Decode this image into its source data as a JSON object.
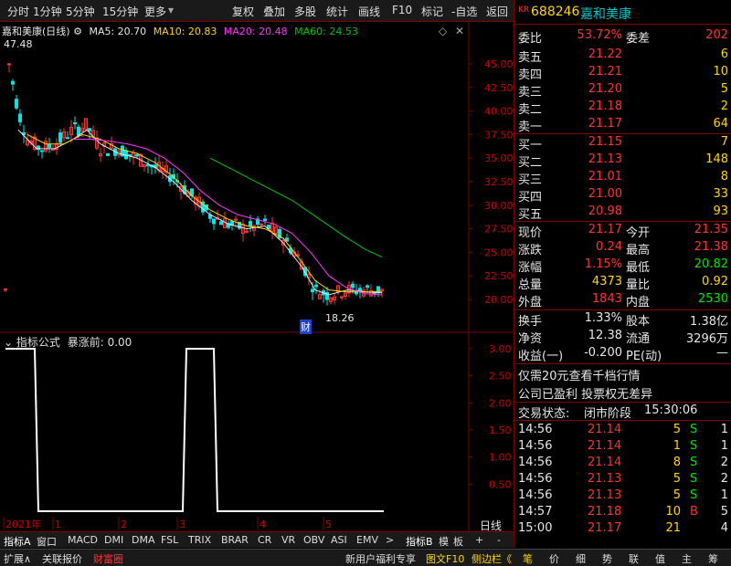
{
  "toolbar": {
    "left": [
      "分时",
      "1分钟",
      "5分钟",
      "15分钟",
      "更多"
    ],
    "right": [
      "复权",
      "叠加",
      "多股",
      "统计",
      "画线",
      "F10",
      "标记",
      "-自选",
      "返回"
    ]
  },
  "chart": {
    "stock_name": "嘉和美康(日线)",
    "ma5": "MA5: 20.70",
    "ma10": "MA10: 20.83",
    "ma20": "MA20: 20.48",
    "ma60": "MA60: 24.53",
    "high_mark": "47.48",
    "low_mark": "18.26",
    "cai_marker": "财",
    "y_ticks": [
      "45.00",
      "42.50",
      "40.00",
      "37.50",
      "35.00",
      "32.50",
      "30.00",
      "27.50",
      "25.00",
      "22.50",
      "20.00"
    ],
    "sub_y_ticks": [
      "3.00",
      "2.50",
      "2.00",
      "1.50",
      "1.00",
      "0.50"
    ],
    "x_labels": [
      "2021年",
      "1",
      "2",
      "3",
      "4",
      "5"
    ],
    "period_label": "日线"
  },
  "indicator": {
    "title": "指标公式",
    "value_label": "暴涨前: 0.00"
  },
  "index_tabs": [
    "指标A",
    "窗口",
    "MACD",
    "DMI",
    "DMA",
    "FSL",
    "TRIX",
    "BRAR",
    "CR",
    "VR",
    "OBV",
    "ASI",
    "EMV",
    ">",
    "指标B",
    "模",
    "板",
    "+",
    "-"
  ],
  "status_bar": {
    "left": [
      "扩展∧",
      "关联报价",
      "财富圈"
    ],
    "promo": "新用户福利专享",
    "f10": "图文F10",
    "sidebar": "侧边栏《",
    "right_tabs": [
      "笔",
      "价",
      "细",
      "势",
      "联",
      "值",
      "主",
      "筹"
    ]
  },
  "quote": {
    "prefix": "KR",
    "code": "688246",
    "name": "嘉和美康",
    "weibi_label": "委比",
    "weibi": "53.72%",
    "weicha_label": "委差",
    "weicha": "202",
    "asks": [
      {
        "label": "卖五",
        "price": "21.22",
        "vol": "6"
      },
      {
        "label": "卖四",
        "price": "21.21",
        "vol": "10"
      },
      {
        "label": "卖三",
        "price": "21.20",
        "vol": "5"
      },
      {
        "label": "卖二",
        "price": "21.18",
        "vol": "2"
      },
      {
        "label": "卖一",
        "price": "21.17",
        "vol": "64"
      }
    ],
    "bids": [
      {
        "label": "买一",
        "price": "21.15",
        "vol": "7"
      },
      {
        "label": "买二",
        "price": "21.13",
        "vol": "148"
      },
      {
        "label": "买三",
        "price": "21.01",
        "vol": "8"
      },
      {
        "label": "买四",
        "price": "21.00",
        "vol": "33"
      },
      {
        "label": "买五",
        "price": "20.98",
        "vol": "93"
      }
    ],
    "stats": [
      {
        "l1": "现价",
        "v1": "21.17",
        "l2": "今开",
        "v2": "21.35"
      },
      {
        "l1": "涨跌",
        "v1": "0.24",
        "l2": "最高",
        "v2": "21.38"
      },
      {
        "l1": "涨幅",
        "v1": "1.15%",
        "l2": "最低",
        "v2": "20.82"
      },
      {
        "l1": "总量",
        "v1": "4373",
        "l2": "量比",
        "v2": "0.92"
      },
      {
        "l1": "外盘",
        "v1": "1843",
        "l2": "内盘",
        "v2": "2530"
      }
    ],
    "stats2": [
      {
        "l1": "换手",
        "v1": "1.33%",
        "l2": "股本",
        "v2": "1.38亿"
      },
      {
        "l1": "净资",
        "v1": "12.38",
        "l2": "流通",
        "v2": "3296万"
      },
      {
        "l1": "收益(一)",
        "v1": "-0.200",
        "l2": "PE(动)",
        "v2": "—"
      }
    ],
    "notice1": "仅需20元查看千档行情",
    "notice2": "公司已盈利 投票权无差异",
    "trade_status_label": "交易状态:",
    "trade_status": "闭市阶段",
    "trade_time": "15:30:06",
    "ticks": [
      {
        "time": "14:56",
        "price": "21.14",
        "vol": "5",
        "bs": "S",
        "n": "1"
      },
      {
        "time": "14:56",
        "price": "21.14",
        "vol": "1",
        "bs": "S",
        "n": "1"
      },
      {
        "time": "14:56",
        "price": "21.14",
        "vol": "8",
        "bs": "S",
        "n": "2"
      },
      {
        "time": "14:56",
        "price": "21.13",
        "vol": "5",
        "bs": "S",
        "n": "2"
      },
      {
        "time": "14:56",
        "price": "21.13",
        "vol": "5",
        "bs": "S",
        "n": "1"
      },
      {
        "time": "14:57",
        "price": "21.18",
        "vol": "10",
        "bs": "B",
        "n": "5"
      },
      {
        "time": "15:00",
        "price": "21.17",
        "vol": "21",
        "bs": "",
        "n": "4"
      }
    ]
  },
  "colors": {
    "up": "#ff3232",
    "down": "#00e6e6",
    "ma5": "#e6e6e6",
    "ma10": "#ffd700",
    "ma20": "#ff32ff",
    "ma60": "#00c800"
  }
}
